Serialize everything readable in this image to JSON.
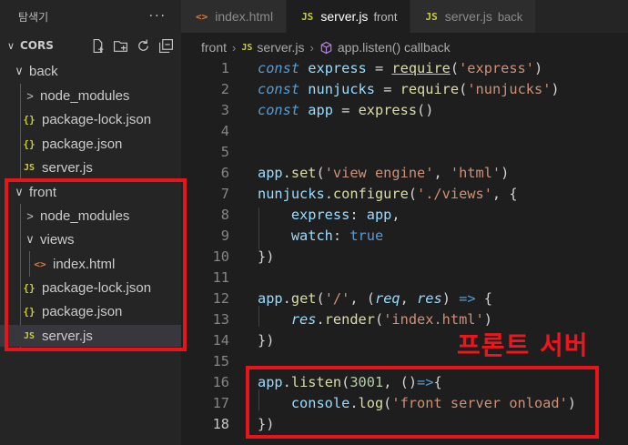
{
  "sidebar": {
    "header_title": "탐색기",
    "more_label": "···",
    "section_title": "CORS",
    "items": [
      {
        "label": "back",
        "kind": "folder-open"
      },
      {
        "label": "node_modules",
        "kind": "folder-closed"
      },
      {
        "label": "package-lock.json",
        "kind": "json"
      },
      {
        "label": "package.json",
        "kind": "json"
      },
      {
        "label": "server.js",
        "kind": "js"
      },
      {
        "label": "front",
        "kind": "folder-open"
      },
      {
        "label": "node_modules",
        "kind": "folder-closed"
      },
      {
        "label": "views",
        "kind": "folder-open"
      },
      {
        "label": "index.html",
        "kind": "html"
      },
      {
        "label": "package-lock.json",
        "kind": "json"
      },
      {
        "label": "package.json",
        "kind": "json"
      },
      {
        "label": "server.js",
        "kind": "js",
        "selected": true
      }
    ],
    "icons": {
      "json": "{}",
      "js": "JS",
      "html": "<>",
      "open": "∨",
      "closed": ">"
    }
  },
  "tabs": [
    {
      "label": "index.html",
      "icon": "<>",
      "description": ""
    },
    {
      "label": "server.js",
      "icon": "JS",
      "description": "front",
      "active": true
    },
    {
      "label": "server.js",
      "icon": "JS",
      "description": "back"
    }
  ],
  "breadcrumb": {
    "folder": "front",
    "file": "server.js",
    "file_icon": "JS",
    "symbol": "app.listen() callback"
  },
  "editor": {
    "current_line": 18,
    "line_numbers": [
      "1",
      "2",
      "3",
      "4",
      "5",
      "6",
      "7",
      "8",
      "9",
      "10",
      "11",
      "12",
      "13",
      "14",
      "15",
      "16",
      "17",
      "18"
    ]
  },
  "annotation": {
    "text": "프론트 서버",
    "color": "#e8141c"
  },
  "colors": {
    "keyword": "#569cd6",
    "variable": "#9cdcfe",
    "function": "#dcdcaa",
    "string": "#ce9178",
    "number": "#b5cea8"
  }
}
